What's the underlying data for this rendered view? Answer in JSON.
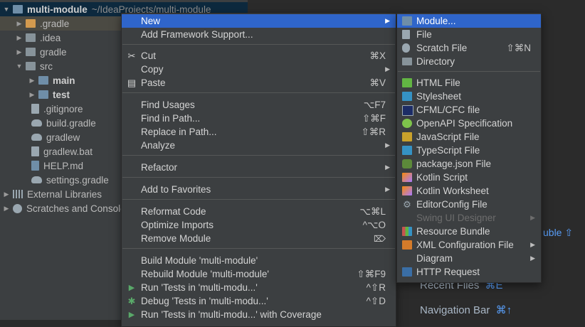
{
  "tree": {
    "rows": [
      {
        "label": "multi-module",
        "path": "~/IdeaProjects/multi-module",
        "icon": "folder-module-icon",
        "expanded": true,
        "bold": true
      },
      {
        "label": ".gradle",
        "icon": "folder-orange-icon",
        "expanded": false
      },
      {
        "label": ".idea",
        "icon": "folder-icon",
        "expanded": false
      },
      {
        "label": "gradle",
        "icon": "folder-icon",
        "expanded": false
      },
      {
        "label": "src",
        "icon": "folder-icon",
        "expanded": true
      },
      {
        "label": "main",
        "icon": "folder-module-icon",
        "expanded": false,
        "bold": true
      },
      {
        "label": "test",
        "icon": "folder-module-icon",
        "expanded": false,
        "bold": true
      },
      {
        "label": ".gitignore",
        "icon": "gitignore-icon"
      },
      {
        "label": "build.gradle",
        "icon": "gradle-icon"
      },
      {
        "label": "gradlew",
        "icon": "gradle-icon"
      },
      {
        "label": "gradlew.bat",
        "icon": "file-icon"
      },
      {
        "label": "HELP.md",
        "icon": "markdown-icon"
      },
      {
        "label": "settings.gradle",
        "icon": "gradle-icon"
      },
      {
        "label": "External Libraries",
        "icon": "libraries-icon",
        "expanded": false
      },
      {
        "label": "Scratches and Consoles",
        "icon": "scratches-icon",
        "expanded": false
      }
    ]
  },
  "background_hints": {
    "hint1_key": "uble ⇧",
    "recent_files": "Recent Files",
    "recent_files_key": "⌘E",
    "navigation_bar": "Navigation Bar",
    "navigation_bar_key": "⌘↑"
  },
  "context_menu": {
    "items": [
      {
        "label": "New",
        "submenu": true,
        "selected": true
      },
      {
        "label": "Add Framework Support..."
      },
      {
        "label": "Cut",
        "shortcut": "⌘X",
        "icon": "scissors-icon"
      },
      {
        "label": "Copy",
        "submenu": true
      },
      {
        "label": "Paste",
        "shortcut": "⌘V",
        "icon": "clipboard-icon"
      },
      {
        "label": "Find Usages",
        "shortcut": "⌥F7"
      },
      {
        "label": "Find in Path...",
        "shortcut": "⇧⌘F"
      },
      {
        "label": "Replace in Path...",
        "shortcut": "⇧⌘R"
      },
      {
        "label": "Analyze",
        "submenu": true
      },
      {
        "label": "Refactor",
        "submenu": true
      },
      {
        "label": "Add to Favorites",
        "submenu": true
      },
      {
        "label": "Reformat Code",
        "shortcut": "⌥⌘L"
      },
      {
        "label": "Optimize Imports",
        "shortcut": "^⌥O"
      },
      {
        "label": "Remove Module",
        "icon_right": "delete-key-icon"
      },
      {
        "label": "Build Module 'multi-module'"
      },
      {
        "label": "Rebuild Module 'multi-module'",
        "shortcut": "⇧⌘F9"
      },
      {
        "label": "Run 'Tests in 'multi-modu...'",
        "shortcut": "^⇧R",
        "icon": "run-icon"
      },
      {
        "label": "Debug 'Tests in 'multi-modu...'",
        "shortcut": "^⇧D",
        "icon": "debug-icon"
      },
      {
        "label": "Run 'Tests in 'multi-modu...' with Coverage",
        "icon": "coverage-icon"
      }
    ]
  },
  "new_submenu": {
    "items": [
      {
        "label": "Module...",
        "icon": "module-icon",
        "selected": true
      },
      {
        "label": "File",
        "icon": "file-icon"
      },
      {
        "label": "Scratch File",
        "shortcut": "⇧⌘N",
        "icon": "scratch-file-icon"
      },
      {
        "label": "Directory",
        "icon": "folder-icon"
      },
      {
        "label": "HTML File",
        "icon": "html-file-icon"
      },
      {
        "label": "Stylesheet",
        "icon": "css-file-icon"
      },
      {
        "label": "CFML/CFC file",
        "icon": "cfml-file-icon"
      },
      {
        "label": "OpenAPI Specification",
        "icon": "openapi-icon"
      },
      {
        "label": "JavaScript File",
        "icon": "javascript-file-icon"
      },
      {
        "label": "TypeScript File",
        "icon": "typescript-file-icon"
      },
      {
        "label": "package.json File",
        "icon": "nodejs-icon"
      },
      {
        "label": "Kotlin Script",
        "icon": "kotlin-icon"
      },
      {
        "label": "Kotlin Worksheet",
        "icon": "kotlin-icon"
      },
      {
        "label": "EditorConfig File",
        "icon": "gear-icon"
      },
      {
        "label": "Swing UI Designer",
        "submenu": true,
        "disabled": true
      },
      {
        "label": "Resource Bundle",
        "icon": "resource-bundle-icon"
      },
      {
        "label": "XML Configuration File",
        "submenu": true,
        "icon": "xml-file-icon"
      },
      {
        "label": "Diagram",
        "submenu": true
      },
      {
        "label": "HTTP Request",
        "icon": "api-icon"
      }
    ]
  },
  "colors": {
    "selection": "#2f65ca",
    "menu_bg": "#3c3f41",
    "tree_selection": "#0d293e"
  }
}
